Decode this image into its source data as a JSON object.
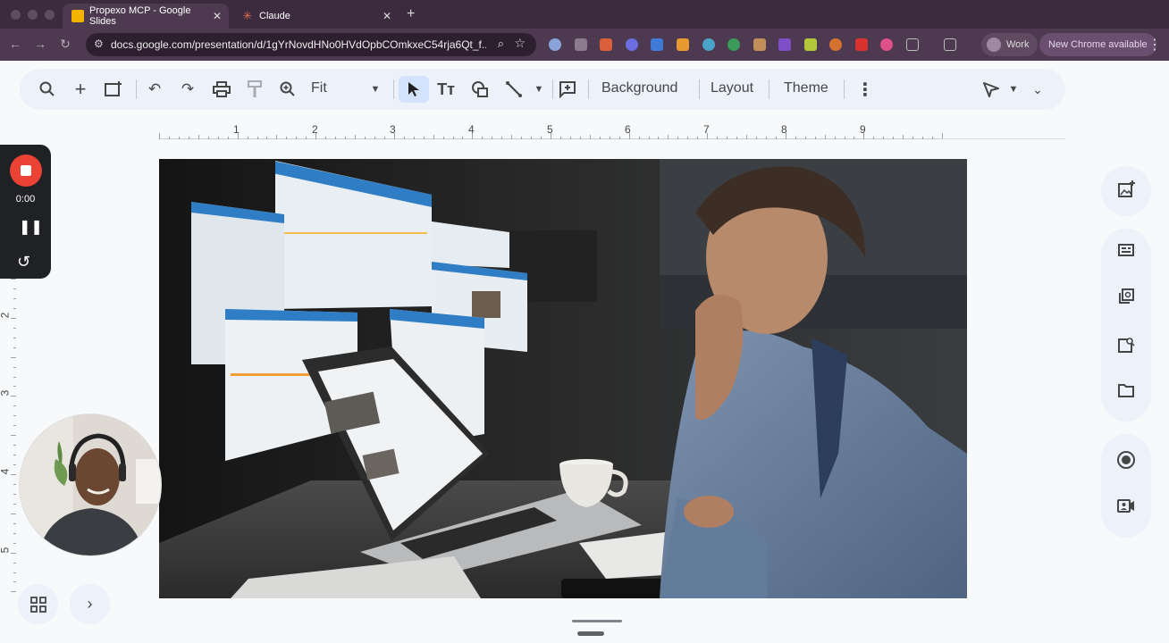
{
  "browser": {
    "tabs": [
      {
        "label": "Propexo MCP - Google Slides",
        "favicon": "slides-icon",
        "active": true
      },
      {
        "label": "Claude",
        "favicon": "claude-icon",
        "active": false
      }
    ],
    "url": "docs.google.com/presentation/d/1gYrNovdHNo0HVdOpbCOmkxeC54rja6Qt_f...",
    "profile_label": "Work",
    "update_label": "New Chrome available"
  },
  "toolbar": {
    "zoom_label": "Fit",
    "background_label": "Background",
    "layout_label": "Layout",
    "theme_label": "Theme"
  },
  "ruler": {
    "h_numbers": [
      "1",
      "2",
      "3",
      "4",
      "5",
      "6",
      "7",
      "8",
      "9"
    ],
    "v_numbers": [
      "2",
      "3",
      "4",
      "5"
    ]
  },
  "recorder": {
    "time": "0:00"
  },
  "colors": {
    "accent_blue": "#1a73e8",
    "record_red": "#ea4335",
    "toolbar_bg": "#edf2fa",
    "tab_bar": "#3c2a3e"
  }
}
